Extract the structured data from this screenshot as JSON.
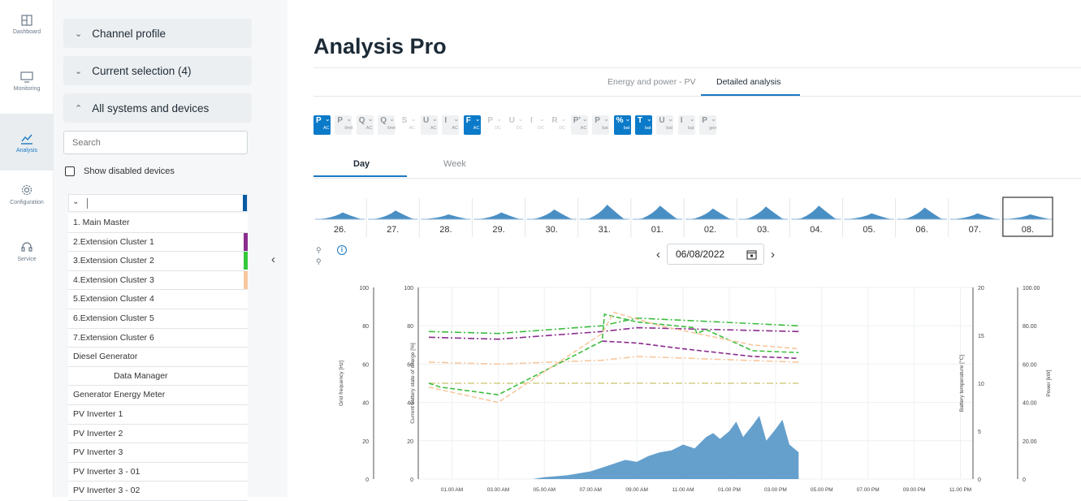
{
  "nav": {
    "items": [
      {
        "label": "Dashboard",
        "icon": "dashboard-icon"
      },
      {
        "label": "Monitoring",
        "icon": "monitor-icon"
      },
      {
        "label": "Analysis",
        "icon": "analysis-icon"
      },
      {
        "label": "Configuration",
        "icon": "gear-icon"
      },
      {
        "label": "Service",
        "icon": "headset-icon"
      }
    ],
    "active": "Analysis"
  },
  "panel": {
    "accordions": [
      "Channel profile",
      "Current selection (4)",
      "All systems and devices"
    ],
    "search_placeholder": "Search",
    "show_disabled_label": "Show disabled devices",
    "devices": [
      {
        "label": "1. Main Master",
        "color": ""
      },
      {
        "label": "2.Extension Cluster 1",
        "color": "#8b2c8e"
      },
      {
        "label": "3.Extension Cluster 2",
        "color": "#35c93a"
      },
      {
        "label": "4.Extension Cluster 3",
        "color": "#f7c89f"
      },
      {
        "label": "5.Extension Cluster 4",
        "color": ""
      },
      {
        "label": "6.Extension Cluster 5",
        "color": ""
      },
      {
        "label": "7.Extension Cluster 6",
        "color": ""
      },
      {
        "label": "Diesel Generator",
        "color": ""
      },
      {
        "label": "Data Manager",
        "color": ""
      },
      {
        "label": "Generator Energy Meter",
        "color": ""
      },
      {
        "label": "PV Inverter 1",
        "color": ""
      },
      {
        "label": "PV Inverter 2",
        "color": ""
      },
      {
        "label": "PV Inverter 3",
        "color": ""
      },
      {
        "label": "PV Inverter 3 - 01",
        "color": ""
      },
      {
        "label": "PV Inverter 3 - 02",
        "color": ""
      }
    ],
    "top_system_color": "#0a5aa3"
  },
  "main": {
    "title": "Analysis Pro",
    "tabs": [
      "Energy and power - PV",
      "Detailed analysis"
    ],
    "active_tab": "Detailed analysis",
    "channels": [
      {
        "l": "P",
        "s": "AC",
        "active": true
      },
      {
        "l": "P",
        "s": "limit",
        "active": false
      },
      {
        "l": "Q",
        "s": "AC",
        "active": false
      },
      {
        "l": "Q",
        "s": "limit",
        "active": false
      },
      {
        "l": "S",
        "s": "AC",
        "active": false,
        "disabled": true
      },
      {
        "l": "U",
        "s": "AC",
        "active": false
      },
      {
        "l": "I",
        "s": "AC",
        "active": false
      },
      {
        "l": "F",
        "s": "AC",
        "active": true
      },
      {
        "l": "P",
        "s": "DC",
        "active": false,
        "disabled": true
      },
      {
        "l": "U",
        "s": "DC",
        "active": false,
        "disabled": true
      },
      {
        "l": "I",
        "s": "DC",
        "active": false,
        "disabled": true
      },
      {
        "l": "R",
        "s": "DC",
        "active": false,
        "disabled": true
      },
      {
        "l": "P'",
        "s": "AC",
        "active": false
      },
      {
        "l": "P",
        "s": "bat",
        "active": false
      },
      {
        "l": "%",
        "s": "bat",
        "active": true
      },
      {
        "l": "T",
        "s": "bat",
        "active": true
      },
      {
        "l": "U",
        "s": "bat",
        "active": false
      },
      {
        "l": "I",
        "s": "bat",
        "active": false
      },
      {
        "l": "P",
        "s": "gen",
        "active": false
      }
    ],
    "period_tabs": [
      "Day",
      "Week"
    ],
    "active_period": "Day",
    "days": [
      "26.",
      "27.",
      "28.",
      "29.",
      "30.",
      "31.",
      "01.",
      "02.",
      "03.",
      "04.",
      "05.",
      "06.",
      "07.",
      "08."
    ],
    "day_peaks": [
      0.35,
      0.45,
      0.25,
      0.35,
      0.5,
      0.75,
      0.7,
      0.55,
      0.65,
      0.7,
      0.3,
      0.6,
      0.3,
      0.25
    ],
    "selected_day": "08.",
    "date": "06/08/2022"
  },
  "chart_data": {
    "type": "line",
    "x_ticks": [
      "01.00 AM",
      "03.00 AM",
      "05.00 AM",
      "07.00 AM",
      "09.00 AM",
      "11.00 AM",
      "01.00 PM",
      "03.00 PM",
      "05.00 PM",
      "07.00 PM",
      "09.00 PM",
      "11.00 PM"
    ],
    "axes": [
      {
        "label": "Grid frequency [Hz]",
        "ticks": [
          "0",
          "20",
          "40",
          "60",
          "80",
          "100"
        ],
        "ylim": [
          0,
          100
        ],
        "side": "left"
      },
      {
        "label": "Current battery state of charge [%]",
        "ticks": [
          "0",
          "20",
          "40",
          "60",
          "80",
          "100"
        ],
        "ylim": [
          0,
          100
        ],
        "side": "left"
      },
      {
        "label": "Battery temperature [°C]",
        "ticks": [
          "0",
          "5",
          "10",
          "15",
          "20"
        ],
        "ylim": [
          0,
          20
        ],
        "side": "right"
      },
      {
        "label": "Power [kW]",
        "ticks": [
          "0",
          "20.00",
          "40.00",
          "60.00",
          "80.00",
          "100.00"
        ],
        "ylim": [
          0,
          100
        ],
        "side": "right"
      }
    ],
    "series": [
      {
        "color": "#3dbd3f",
        "style": "dash-dot",
        "x": [
          0,
          3,
          7.5,
          9,
          16
        ],
        "y": [
          77,
          76,
          80,
          84,
          80
        ]
      },
      {
        "color": "#8b2c8e",
        "style": "dash-dot",
        "x": [
          0,
          3,
          7.5,
          9,
          16
        ],
        "y": [
          74,
          73,
          77,
          79,
          77
        ]
      },
      {
        "color": "#f7c89f",
        "style": "dash-dot",
        "x": [
          0,
          3,
          7.5,
          9,
          16
        ],
        "y": [
          61,
          60,
          62,
          64,
          61
        ]
      },
      {
        "color": "#d4cc86",
        "style": "dash-dot",
        "x": [
          0,
          16
        ],
        "y": [
          50,
          50
        ]
      },
      {
        "color": "#3dbd3f",
        "style": "dash",
        "x": [
          0,
          0.5,
          3,
          7.5,
          7.6,
          9,
          11.5,
          11.6,
          12,
          14,
          16
        ],
        "y": [
          50,
          48,
          44,
          72,
          86,
          82,
          79,
          76,
          78,
          67,
          66
        ]
      },
      {
        "color": "#8b2c8e",
        "style": "dash",
        "x": [
          7.5,
          9,
          11,
          14,
          16
        ],
        "y": [
          72,
          71,
          68,
          64,
          63
        ]
      },
      {
        "color": "#f7c89f",
        "style": "dash",
        "x": [
          0,
          3,
          7.5,
          8,
          10,
          14,
          16
        ],
        "y": [
          48,
          40,
          76,
          87,
          80,
          70,
          68
        ]
      }
    ],
    "area": {
      "color": "#4a8fc4",
      "x": [
        4.5,
        5,
        5.5,
        6,
        6.5,
        7,
        7.5,
        8,
        8.5,
        9,
        9.5,
        10,
        10.5,
        11,
        11.5,
        12,
        12.3,
        12.6,
        13,
        13.3,
        13.6,
        14,
        14.3,
        14.6,
        15,
        15.3,
        15.6,
        16
      ],
      "y": [
        0,
        1,
        1.5,
        2,
        3,
        4,
        6,
        8,
        10,
        9,
        12,
        14,
        15,
        18,
        16,
        22,
        24,
        21,
        25,
        30,
        22,
        28,
        33,
        20,
        26,
        31,
        18,
        14
      ]
    }
  }
}
